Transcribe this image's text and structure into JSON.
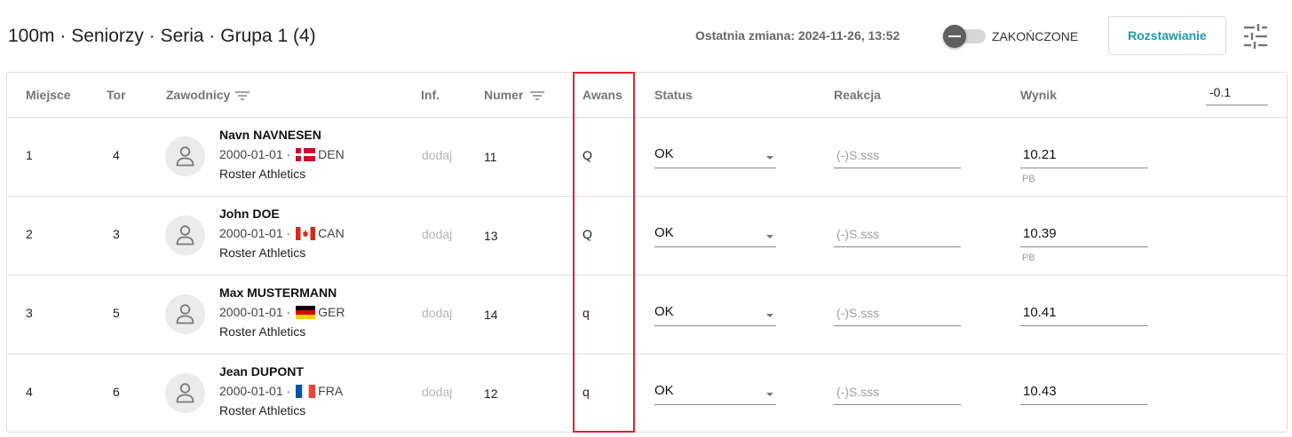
{
  "header": {
    "title": "100m · Seniorzy · Seria · Grupa 1 (4)",
    "last_change": "Ostatnia zmiana: 2024-11-26, 13:52",
    "toggle_label": "ZAKOŃCZONE",
    "toggle_on": false,
    "seeding_button": "Rozstawianie",
    "settings_icon": "sliders-icon"
  },
  "table": {
    "columns": {
      "place": "Miejsce",
      "lane": "Tor",
      "athletes": "Zawodnicy",
      "info": "Inf.",
      "number": "Numer",
      "advance": "Awans",
      "status": "Status",
      "reaction": "Reakcja",
      "result": "Wynik"
    },
    "wind": "-0.1",
    "reaction_placeholder": "(-)S.sss",
    "rows": [
      {
        "place": "1",
        "lane": "4",
        "name": "Navn NAVNESEN",
        "dob": "2000-01-01 ·",
        "country": "DEN",
        "club": "Roster Athletics",
        "info": "dodaj",
        "number": "11",
        "advance": "Q",
        "status": "OK",
        "result": "10.21",
        "note": "PB"
      },
      {
        "place": "2",
        "lane": "3",
        "name": "John DOE",
        "dob": "2000-01-01 ·",
        "country": "CAN",
        "club": "Roster Athletics",
        "info": "dodaj",
        "number": "13",
        "advance": "Q",
        "status": "OK",
        "result": "10.39",
        "note": "PB"
      },
      {
        "place": "3",
        "lane": "5",
        "name": "Max MUSTERMANN",
        "dob": "2000-01-01 ·",
        "country": "GER",
        "club": "Roster Athletics",
        "info": "dodaj",
        "number": "14",
        "advance": "q",
        "status": "OK",
        "result": "10.41",
        "note": ""
      },
      {
        "place": "4",
        "lane": "6",
        "name": "Jean DUPONT",
        "dob": "2000-01-01 ·",
        "country": "FRA",
        "club": "Roster Athletics",
        "info": "dodaj",
        "number": "12",
        "advance": "q",
        "status": "OK",
        "result": "10.43",
        "note": ""
      }
    ]
  },
  "colors": {
    "accent": "#1a9bab",
    "highlight": "#d9262f"
  }
}
